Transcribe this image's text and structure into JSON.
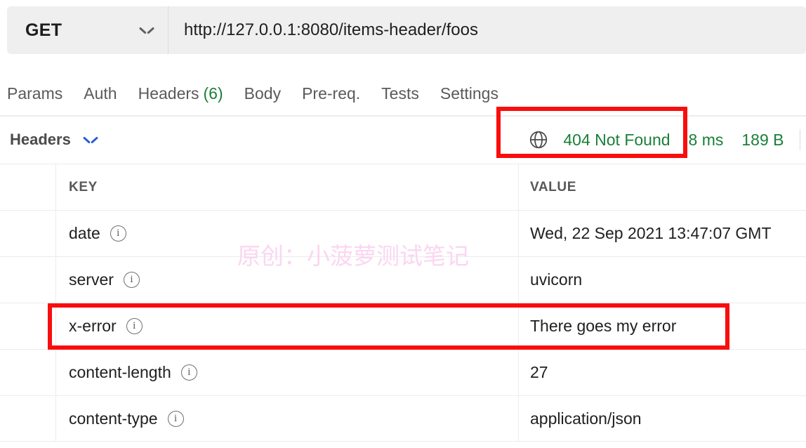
{
  "request": {
    "method": "GET",
    "method_icon": "chevron-down-icon",
    "url": "http://127.0.0.1:8080/items-header/foos"
  },
  "tabs": [
    {
      "label": "Params",
      "count": ""
    },
    {
      "label": "Auth",
      "count": ""
    },
    {
      "label": "Headers",
      "count": "(6)"
    },
    {
      "label": "Body",
      "count": ""
    },
    {
      "label": "Pre-req.",
      "count": ""
    },
    {
      "label": "Tests",
      "count": ""
    },
    {
      "label": "Settings",
      "count": ""
    }
  ],
  "response": {
    "section_title": "Headers",
    "toggle_icon": "chevron-down-icon",
    "globe_icon": "globe-icon",
    "status": "404 Not Found",
    "time": "8 ms",
    "size": "189 B",
    "status_color": "#1a7f37"
  },
  "table": {
    "columns": [
      "KEY",
      "VALUE"
    ],
    "rows": [
      {
        "key": "date",
        "value": "Wed, 22 Sep 2021 13:47:07 GMT",
        "info_icon": "info-icon"
      },
      {
        "key": "server",
        "value": "uvicorn",
        "info_icon": "info-icon"
      },
      {
        "key": "x-error",
        "value": "There goes my error",
        "info_icon": "info-icon"
      },
      {
        "key": "content-length",
        "value": "27",
        "info_icon": "info-icon"
      },
      {
        "key": "content-type",
        "value": "application/json",
        "info_icon": "info-icon"
      }
    ]
  },
  "annotations": {
    "highlight_color": "#fa0d0d",
    "boxes": [
      "status-highlight",
      "x-error-row-highlight"
    ]
  },
  "watermark": {
    "text": "原创：小菠萝测试笔记",
    "color": "#fbd6f2"
  }
}
